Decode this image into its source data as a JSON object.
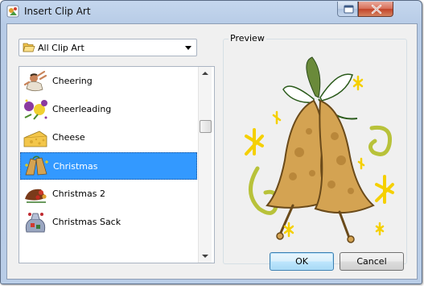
{
  "window": {
    "title": "Insert Clip Art"
  },
  "category": {
    "selected": "All Clip Art",
    "icon": "folder-open-icon"
  },
  "cliplist": {
    "items": [
      {
        "label": "Cheering",
        "icon": "cheering-man-clipart"
      },
      {
        "label": "Cheerleading",
        "icon": "cheerleading-pompoms-clipart"
      },
      {
        "label": "Cheese",
        "icon": "cheese-wedge-clipart"
      },
      {
        "label": "Christmas",
        "icon": "christmas-bells-clipart",
        "selected": true
      },
      {
        "label": "Christmas 2",
        "icon": "cornucopia-clipart"
      },
      {
        "label": "Christmas Sack",
        "icon": "christmas-sack-clipart"
      }
    ]
  },
  "preview": {
    "legend": "Preview",
    "image": "christmas-bells-illustration"
  },
  "buttons": {
    "ok": "OK",
    "cancel": "Cancel"
  },
  "colors": {
    "selection": "#3399ff",
    "bell": "#d4a352",
    "star": "#f5d000",
    "swirl": "#b8c23a"
  }
}
